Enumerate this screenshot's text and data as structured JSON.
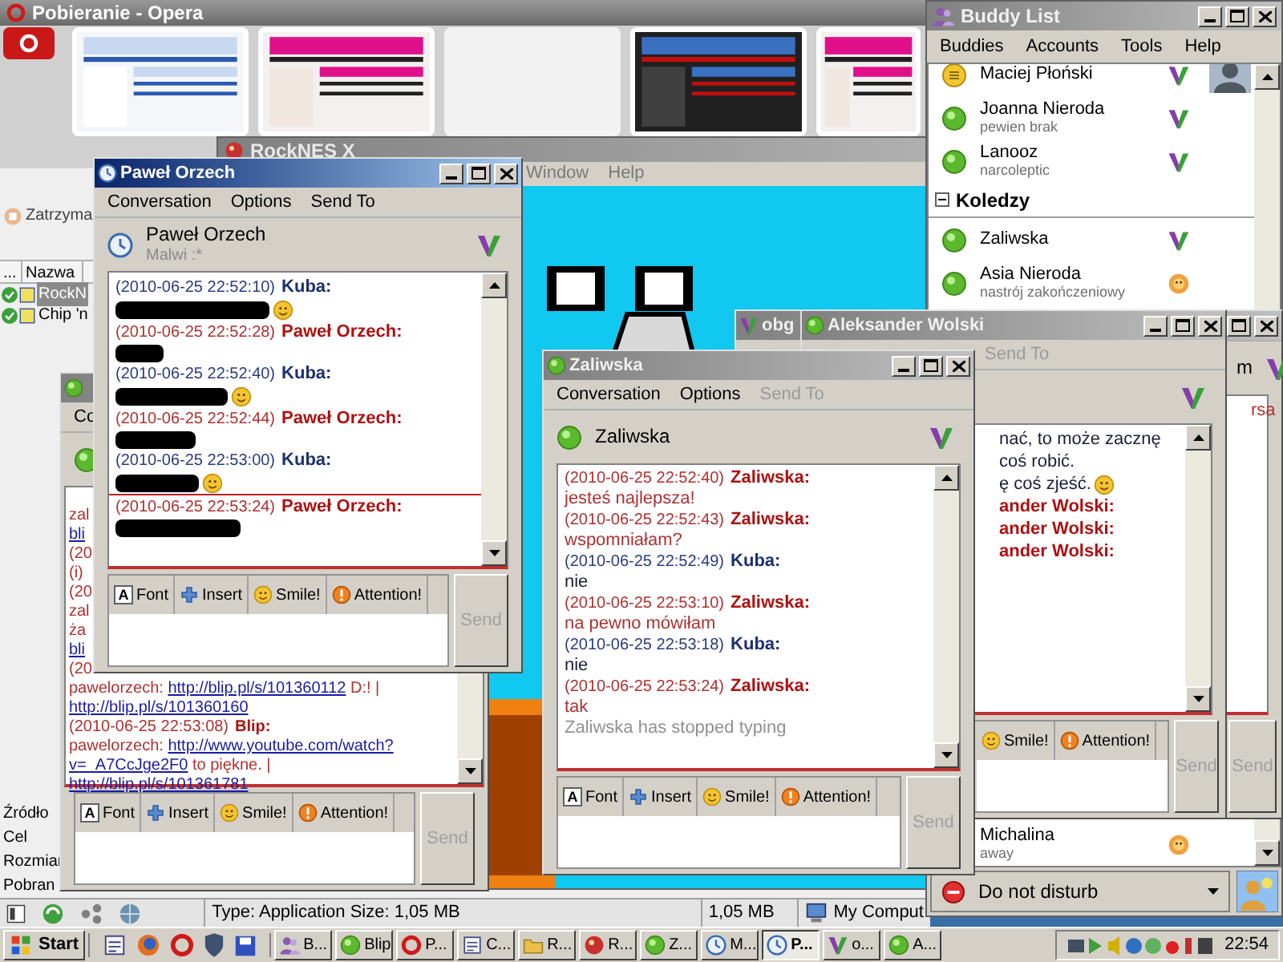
{
  "opera": {
    "title": "Pobieranie - Opera",
    "stop_button": "Zatrzyma",
    "columns": [
      "...",
      "Nazwa"
    ],
    "downloads": [
      {
        "name": "RockN",
        "selected": true
      },
      {
        "name": "Chip 'n",
        "selected": false
      }
    ],
    "details": [
      "Źródło",
      "Cel",
      "Rozmiar",
      "Pobran"
    ],
    "status": [
      "Type: Application Size: 1,05 MB",
      "1,05 MB",
      "My Comput"
    ]
  },
  "rocknes": {
    "title": "RockNES X",
    "menu": [
      "Window",
      "Help"
    ]
  },
  "buddy_list": {
    "title": "Buddy List",
    "menu": [
      "Buddies",
      "Accounts",
      "Tools",
      "Help"
    ],
    "buddies": [
      {
        "kind": "buddy",
        "name": "Maciej Płoński",
        "avatar": true
      },
      {
        "kind": "buddy",
        "name": "Joanna Nieroda",
        "message": "pewien brak"
      },
      {
        "kind": "buddy",
        "name": "Lanooz",
        "message": "narcoleptic"
      },
      {
        "kind": "group",
        "name": "Koledzy",
        "expanded": true,
        "children": [
          {
            "kind": "buddy",
            "name": "Zaliwska"
          },
          {
            "kind": "buddy",
            "name": "Asia Nieroda",
            "message": "nastrój zakończeniowy"
          },
          {
            "kind": "buddy",
            "name": "Michalina",
            "message": "away"
          }
        ]
      }
    ],
    "status": "Do not disturb"
  },
  "chats": [
    {
      "active": false,
      "header": {
        "name": "m"
      },
      "messages": [
        {
          "kind": "incoming",
          "segments": [
            {
              "text": "rsa"
            }
          ]
        }
      ],
      "send": "Send"
    },
    {
      "active": false,
      "title": "obg"
    },
    {
      "active": false,
      "title": "Aleksander Wolski",
      "menu": [
        {
          "label": "Send To",
          "disabled": true
        }
      ],
      "messages": [
        {
          "kind": "outgoing",
          "segments": [
            {
              "text": "nać, to może zacznę coś robić."
            }
          ]
        },
        {
          "kind": "outgoing",
          "segments": [
            {
              "text": "ę coś zjeść."
            }
          ],
          "emoticon": true
        },
        {
          "kind": "incoming",
          "author": "ander Wolski:"
        },
        {
          "kind": "incoming",
          "author": "ander Wolski:"
        },
        {
          "kind": "incoming",
          "author": "ander Wolski:"
        }
      ],
      "toolbar": [
        {
          "kind": "smile",
          "label": "Smile!"
        },
        {
          "kind": "attention",
          "label": "Attention!"
        }
      ],
      "send": "Send"
    },
    {
      "active": false,
      "menu": [
        {
          "label": "Co",
          "disabled": false
        }
      ],
      "messages": [
        {
          "kind": "incoming",
          "segments": [
            {
              "text": "zal"
            }
          ]
        },
        {
          "kind": "outgoing",
          "segments": [
            {
              "text": "bli",
              "link": true
            }
          ]
        },
        {
          "kind": "incoming",
          "segments": [
            {
              "text": "(20"
            }
          ]
        },
        {
          "kind": "incoming",
          "segments": [
            {
              "text": "(i)"
            }
          ]
        },
        {
          "kind": "incoming",
          "segments": [
            {
              "text": "(20"
            }
          ]
        },
        {
          "kind": "incoming",
          "segments": [
            {
              "text": "zal"
            }
          ]
        },
        {
          "kind": "incoming",
          "segments": [
            {
              "text": "ża"
            }
          ]
        },
        {
          "kind": "outgoing",
          "segments": [
            {
              "text": "bli",
              "link": true
            }
          ]
        },
        {
          "kind": "incoming",
          "segments": [
            {
              "text": "(20"
            }
          ]
        },
        {
          "kind": "incoming",
          "segments": [
            {
              "text": "pawelorzech: "
            },
            {
              "text": "http://blip.pl/s/101360112",
              "link": true
            },
            {
              "text": " D:! | "
            },
            {
              "text": "http://blip.pl/s/101360160",
              "link": true
            }
          ]
        },
        {
          "kind": "incoming",
          "time": "(2010-06-25 22:53:08)",
          "author": "Blip:"
        },
        {
          "kind": "incoming",
          "segments": [
            {
              "text": "pawelorzech: "
            },
            {
              "text": "http://www.youtube.com/watch?",
              "link": true
            },
            {
              "text": "v=_A7CcJge2F0",
              "link": true
            },
            {
              "text": " to piękne. | "
            },
            {
              "text": "http://blip.pl/s/101361781",
              "link": true
            }
          ]
        }
      ],
      "toolbar": [
        {
          "kind": "font",
          "glyph": "A",
          "label": "Font"
        },
        {
          "kind": "insert",
          "label": "Insert"
        },
        {
          "kind": "smile",
          "label": "Smile!"
        },
        {
          "kind": "attention",
          "label": "Attention!"
        }
      ],
      "send": "Send"
    },
    {
      "active": true,
      "title": "Paweł Orzech",
      "menu": [
        {
          "label": "Conversation",
          "disabled": false
        },
        {
          "label": "Options",
          "disabled": false
        },
        {
          "label": "Send To",
          "disabled": false
        }
      ],
      "header": {
        "name": "Paweł Orzech",
        "message": "Malwi :*"
      },
      "messages": [
        {
          "kind": "outgoing",
          "time": "(2010-06-25 22:52:10)",
          "author": "Kuba:",
          "redacted": true,
          "emoticon": true
        },
        {
          "kind": "incoming",
          "time": "(2010-06-25 22:52:28)",
          "author": "Paweł Orzech:",
          "redacted": true
        },
        {
          "kind": "outgoing",
          "time": "(2010-06-25 22:52:40)",
          "author": "Kuba:",
          "redacted": true,
          "emoticon": true
        },
        {
          "kind": "incoming",
          "time": "(2010-06-25 22:52:44)",
          "author": "Paweł Orzech:",
          "redacted": true
        },
        {
          "kind": "outgoing",
          "time": "(2010-06-25 22:53:00)",
          "author": "Kuba:",
          "redacted": true,
          "emoticon": true
        },
        {
          "kind": "incoming",
          "time": "(2010-06-25 22:53:24)",
          "author": "Paweł Orzech:",
          "redacted": true,
          "divider": true
        }
      ],
      "toolbar": [
        {
          "kind": "font",
          "glyph": "A",
          "label": "Font"
        },
        {
          "kind": "insert",
          "label": "Insert"
        },
        {
          "kind": "smile",
          "label": "Smile!"
        },
        {
          "kind": "attention",
          "label": "Attention!"
        }
      ],
      "send": "Send"
    },
    {
      "active": false,
      "title": "Zaliwska",
      "menu": [
        {
          "label": "Conversation",
          "disabled": false
        },
        {
          "label": "Options",
          "disabled": false
        },
        {
          "label": "Send To",
          "disabled": true
        }
      ],
      "header": {
        "name": "Zaliwska"
      },
      "messages": [
        {
          "kind": "incoming",
          "time": "(2010-06-25 22:52:40)",
          "author": "Zaliwska:",
          "segments": [
            {
              "text": "jesteś najlepsza!"
            }
          ]
        },
        {
          "kind": "incoming",
          "time": "(2010-06-25 22:52:43)",
          "author": "Zaliwska:",
          "segments": [
            {
              "text": "wspomniałam?"
            }
          ]
        },
        {
          "kind": "outgoing",
          "time": "(2010-06-25 22:52:49)",
          "author": "Kuba:",
          "segments": [
            {
              "text": "nie"
            }
          ]
        },
        {
          "kind": "incoming",
          "time": "(2010-06-25 22:53:10)",
          "author": "Zaliwska:",
          "segments": [
            {
              "text": "na pewno mówiłam"
            }
          ]
        },
        {
          "kind": "outgoing",
          "time": "(2010-06-25 22:53:18)",
          "author": "Kuba:",
          "segments": [
            {
              "text": "nie"
            }
          ]
        },
        {
          "kind": "incoming",
          "time": "(2010-06-25 22:53:24)",
          "author": "Zaliwska:",
          "segments": [
            {
              "text": "tak"
            }
          ]
        }
      ],
      "typing": "Zaliwska has stopped typing",
      "toolbar": [
        {
          "kind": "font",
          "glyph": "A",
          "label": "Font"
        },
        {
          "kind": "insert",
          "label": "Insert"
        },
        {
          "kind": "smile",
          "label": "Smile!"
        },
        {
          "kind": "attention",
          "label": "Attention!"
        }
      ],
      "send": "Send"
    }
  ],
  "taskbar": {
    "start": "Start",
    "tasks": [
      {
        "label": "B...",
        "selected": false
      },
      {
        "label": "Blip",
        "selected": false
      },
      {
        "label": "P...",
        "selected": false
      },
      {
        "label": "C...",
        "selected": false
      },
      {
        "label": "R...",
        "selected": false
      },
      {
        "label": "R...",
        "selected": false
      },
      {
        "label": "Z...",
        "selected": false
      },
      {
        "label": "M...",
        "selected": false
      },
      {
        "label": "P...",
        "selected": true
      },
      {
        "label": "o...",
        "selected": false
      },
      {
        "label": "A...",
        "selected": false
      }
    ],
    "clock": "22:54"
  }
}
